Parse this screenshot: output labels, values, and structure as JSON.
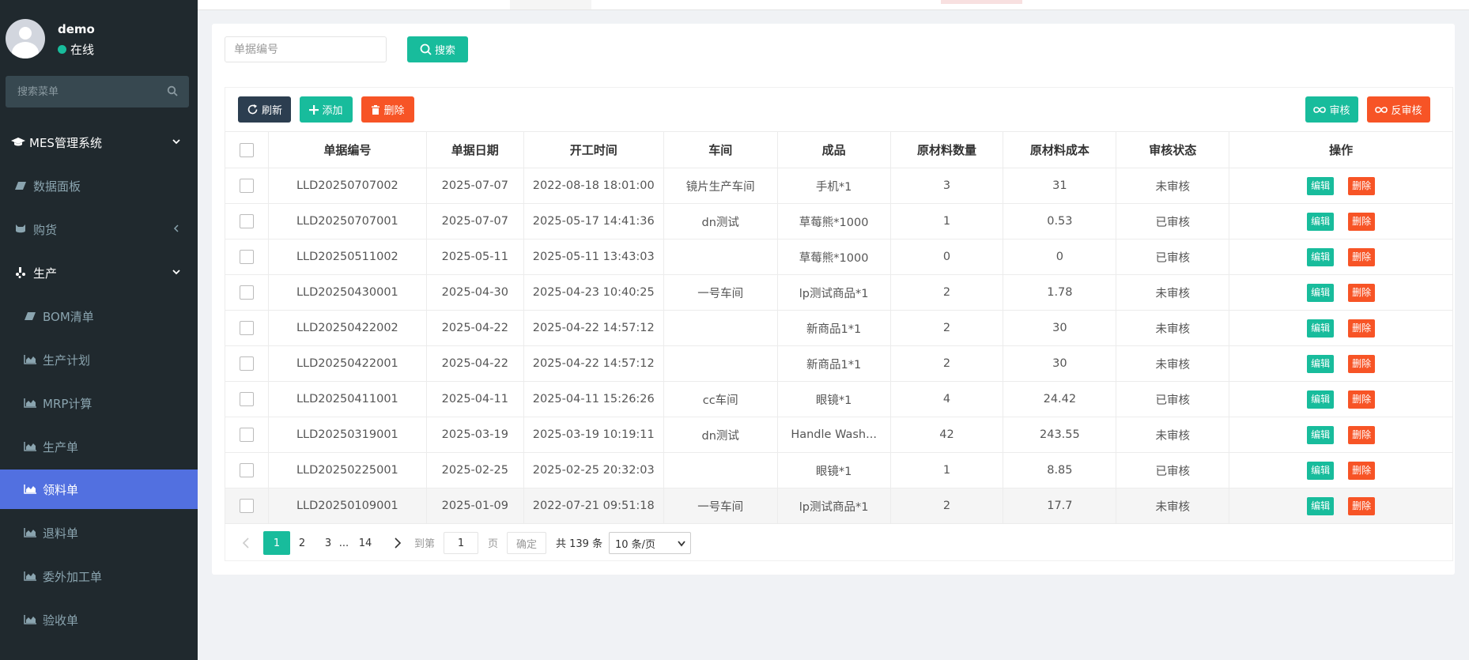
{
  "user": {
    "name": "demo",
    "status": "在线"
  },
  "sidebar": {
    "search_placeholder": "搜索菜单",
    "header": "MES管理系统",
    "items": [
      {
        "label": "数据面板"
      },
      {
        "label": "购货"
      },
      {
        "label": "生产"
      },
      {
        "label": "BOM清单"
      },
      {
        "label": "生产计划"
      },
      {
        "label": "MRP计算"
      },
      {
        "label": "生产单"
      },
      {
        "label": "领料单"
      },
      {
        "label": "退料单"
      },
      {
        "label": "委外加工单"
      },
      {
        "label": "验收单"
      }
    ]
  },
  "search": {
    "placeholder": "单据编号",
    "button": "搜索"
  },
  "toolbar": {
    "refresh": "刷新",
    "add": "添加",
    "delete": "删除",
    "approve": "审核",
    "unapprove": "反审核"
  },
  "table": {
    "headers": [
      "单据编号",
      "单据日期",
      "开工时间",
      "车间",
      "成品",
      "原材料数量",
      "原材料成本",
      "审核状态",
      "操作"
    ],
    "rows": [
      [
        "LLD20250707002",
        "2025-07-07",
        "2022-08-18 18:01:00",
        "镜片生产车间",
        "手机*1",
        "3",
        "31",
        "未审核"
      ],
      [
        "LLD20250707001",
        "2025-07-07",
        "2025-05-17 14:41:36",
        "dn测试",
        "草莓熊*1000",
        "1",
        "0.53",
        "已审核"
      ],
      [
        "LLD20250511002",
        "2025-05-11",
        "2025-05-11 13:43:03",
        "",
        "草莓熊*1000",
        "0",
        "0",
        "已审核"
      ],
      [
        "LLD20250430001",
        "2025-04-30",
        "2025-04-23 10:40:25",
        "一号车间",
        "lp测试商品*1",
        "2",
        "1.78",
        "未审核"
      ],
      [
        "LLD20250422002",
        "2025-04-22",
        "2025-04-22 14:57:12",
        "",
        "新商品1*1",
        "2",
        "30",
        "未审核"
      ],
      [
        "LLD20250422001",
        "2025-04-22",
        "2025-04-22 14:57:12",
        "",
        "新商品1*1",
        "2",
        "30",
        "未审核"
      ],
      [
        "LLD20250411001",
        "2025-04-11",
        "2025-04-11 15:26:26",
        "cc车间",
        "眼镜*1",
        "4",
        "24.42",
        "已审核"
      ],
      [
        "LLD20250319001",
        "2025-03-19",
        "2025-03-19 10:19:11",
        "dn测试",
        "Handle Wash...",
        "42",
        "243.55",
        "未审核"
      ],
      [
        "LLD20250225001",
        "2025-02-25",
        "2025-02-25 20:32:03",
        "",
        "眼镜*1",
        "1",
        "8.85",
        "已审核"
      ],
      [
        "LLD20250109001",
        "2025-01-09",
        "2022-07-21 09:51:18",
        "一号车间",
        "lp测试商品*1",
        "2",
        "17.7",
        "未审核"
      ]
    ],
    "row_edit": "编辑",
    "row_delete": "删除"
  },
  "pagination": {
    "pages": [
      "1",
      "2",
      "3",
      "...",
      "14"
    ],
    "goto_label": "到第",
    "goto_value": "1",
    "page_unit": "页",
    "confirm": "确定",
    "total": "共 139 条",
    "page_size": "10 条/页"
  },
  "colors": {
    "sidebar": "#20292e",
    "active": "#5270e0",
    "primary": "#18bc9c",
    "danger": "#f75426",
    "dark": "#2c3e50"
  }
}
